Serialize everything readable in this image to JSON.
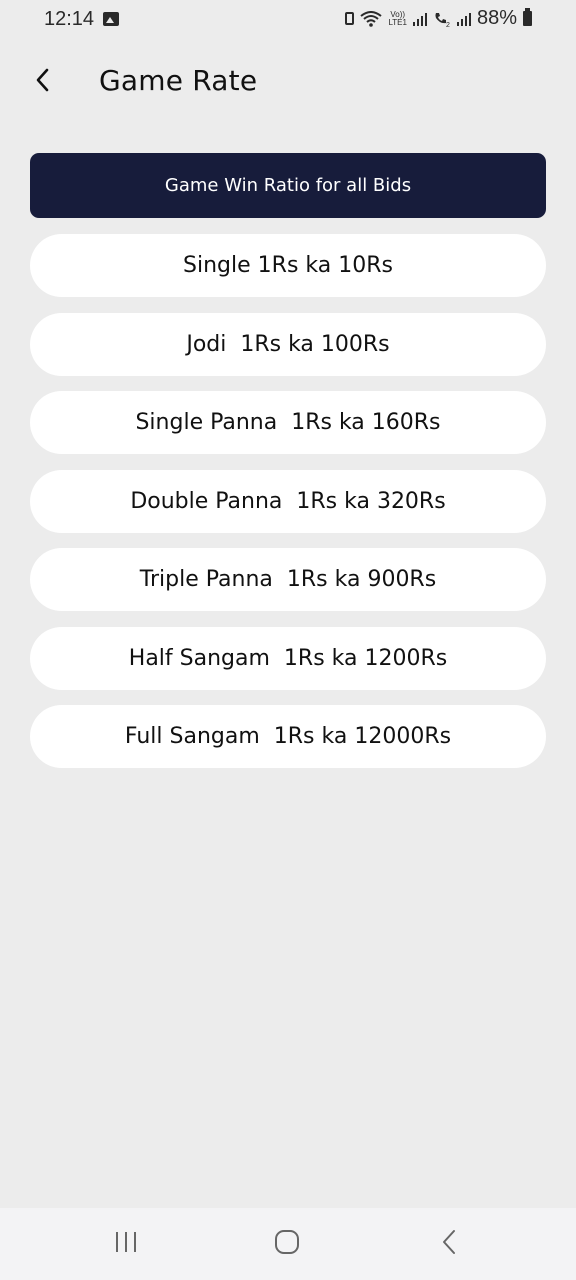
{
  "status_bar": {
    "time": "12:14",
    "volte_label": "Vo))",
    "lte_label": "LTE1",
    "battery": "88%"
  },
  "header": {
    "title": "Game Rate"
  },
  "banner": {
    "label": "Game Win Ratio for all Bids"
  },
  "rates": [
    {
      "label": "Single 1Rs ka 10Rs"
    },
    {
      "label": "Jodi  1Rs ka 100Rs"
    },
    {
      "label": "Single Panna  1Rs ka 160Rs"
    },
    {
      "label": "Double Panna  1Rs ka 320Rs"
    },
    {
      "label": "Triple Panna  1Rs ka 900Rs"
    },
    {
      "label": "Half Sangam  1Rs ka 1200Rs"
    },
    {
      "label": "Full Sangam  1Rs ka 12000Rs"
    }
  ],
  "colors": {
    "background": "#ececec",
    "banner": "#171c3b",
    "card": "#ffffff"
  },
  "icons": {
    "back": "chevron-left-icon",
    "recent": "recent-apps-icon",
    "home": "home-icon",
    "nav_back": "back-icon"
  }
}
